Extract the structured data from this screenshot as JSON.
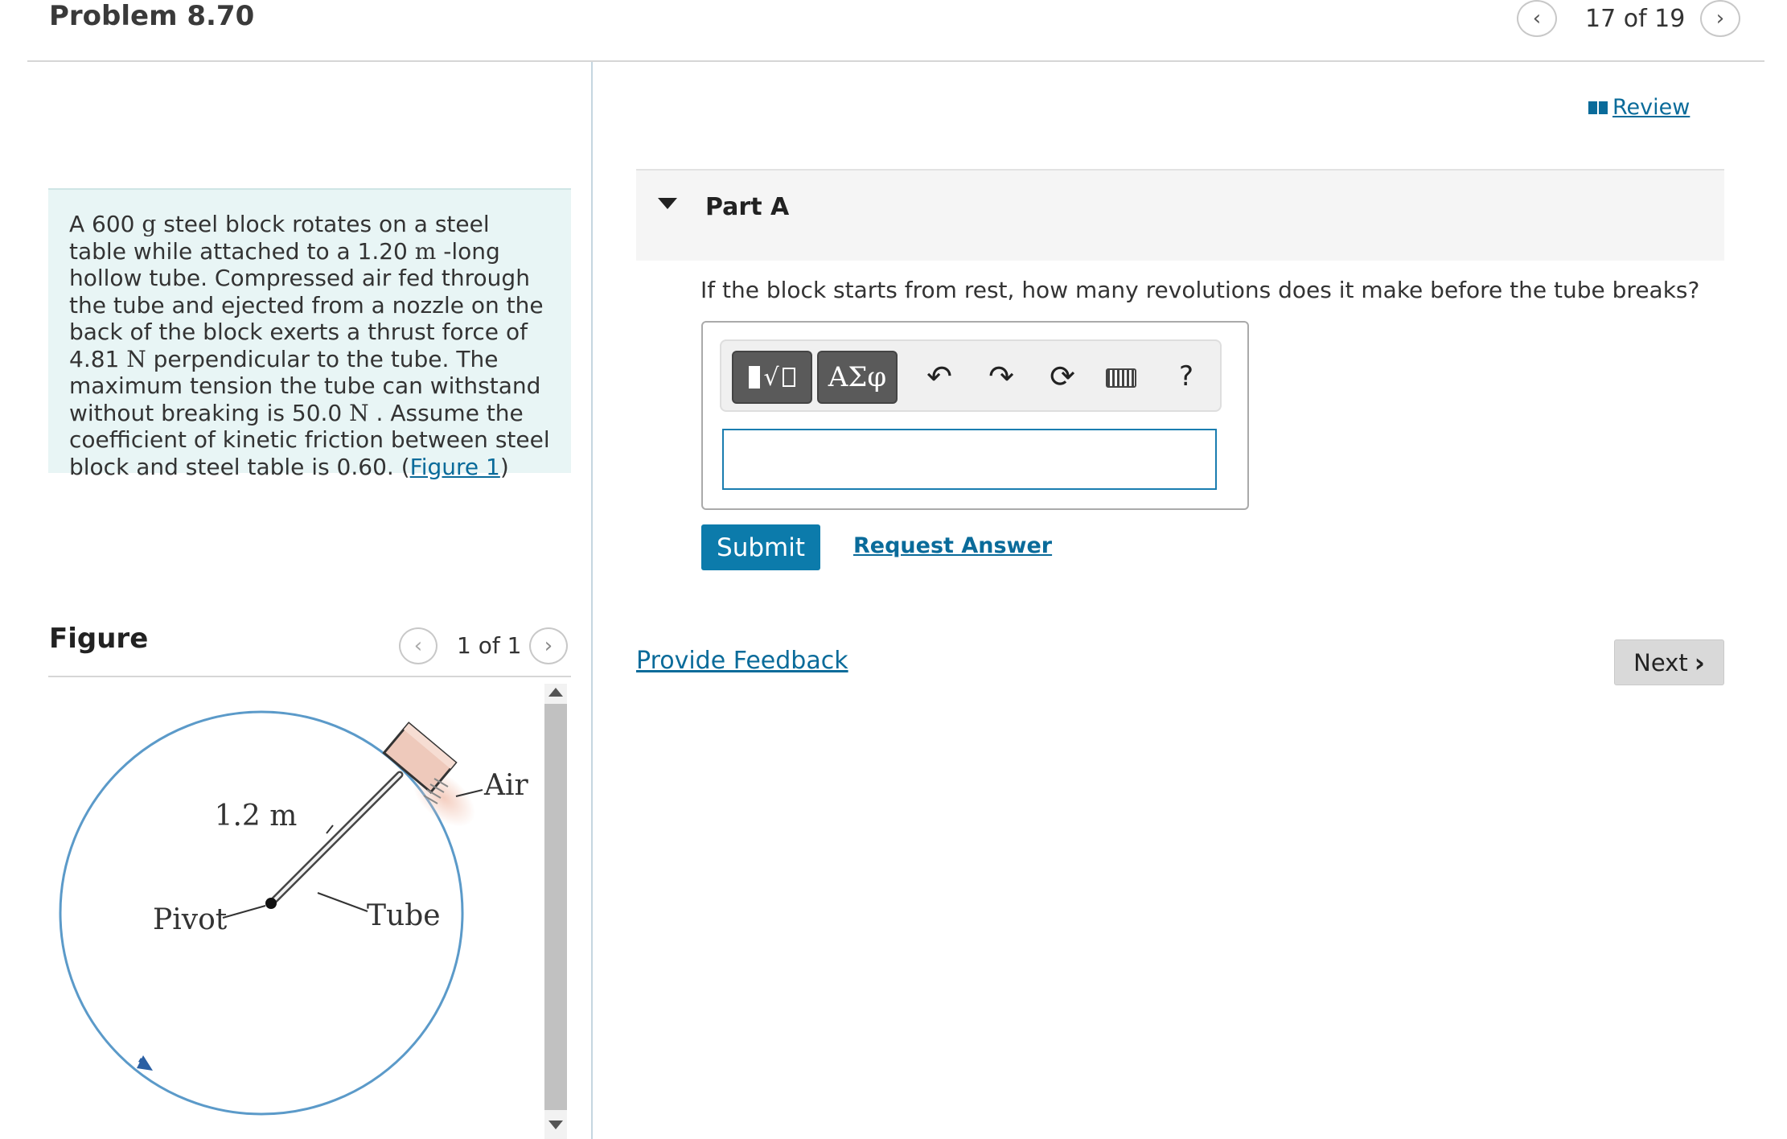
{
  "header": {
    "title": "Problem 8.70",
    "pager": "17 of 19"
  },
  "problem": {
    "text_parts": [
      "A 600 ",
      "g",
      " steel block rotates on a steel table while attached to a 1.20 ",
      "m",
      " -long hollow tube. Compressed air fed through the tube and ejected from a nozzle on the back of the block exerts a thrust force of 4.81 ",
      "N",
      " perpendicular to the tube. The maximum tension the tube can withstand without breaking is 50.0 ",
      "N",
      " . Assume the coefficient of kinetic friction between steel block and steel table is 0.60. (",
      "Figure 1",
      ")"
    ]
  },
  "figure": {
    "title": "Figure",
    "pager": "1 of 1",
    "labels": {
      "length": "1.2 m",
      "air": "Air",
      "tube": "Tube",
      "pivot": "Pivot"
    }
  },
  "review": {
    "label": "Review",
    "icon": "book-icon"
  },
  "part_a": {
    "title": "Part A",
    "question": "If the block starts from rest, how many revolutions does it make before the tube breaks?",
    "input_value": ""
  },
  "toolbar": {
    "templates_icon": "templates-icon",
    "greek_label": "ΑΣφ",
    "help_label": "?"
  },
  "actions": {
    "submit": "Submit",
    "request_answer": "Request Answer",
    "feedback": "Provide Feedback",
    "next": "Next"
  },
  "colors": {
    "accent": "#0c7bab",
    "link": "#0a6b9a",
    "problem_bg": "#e8f5f5"
  }
}
